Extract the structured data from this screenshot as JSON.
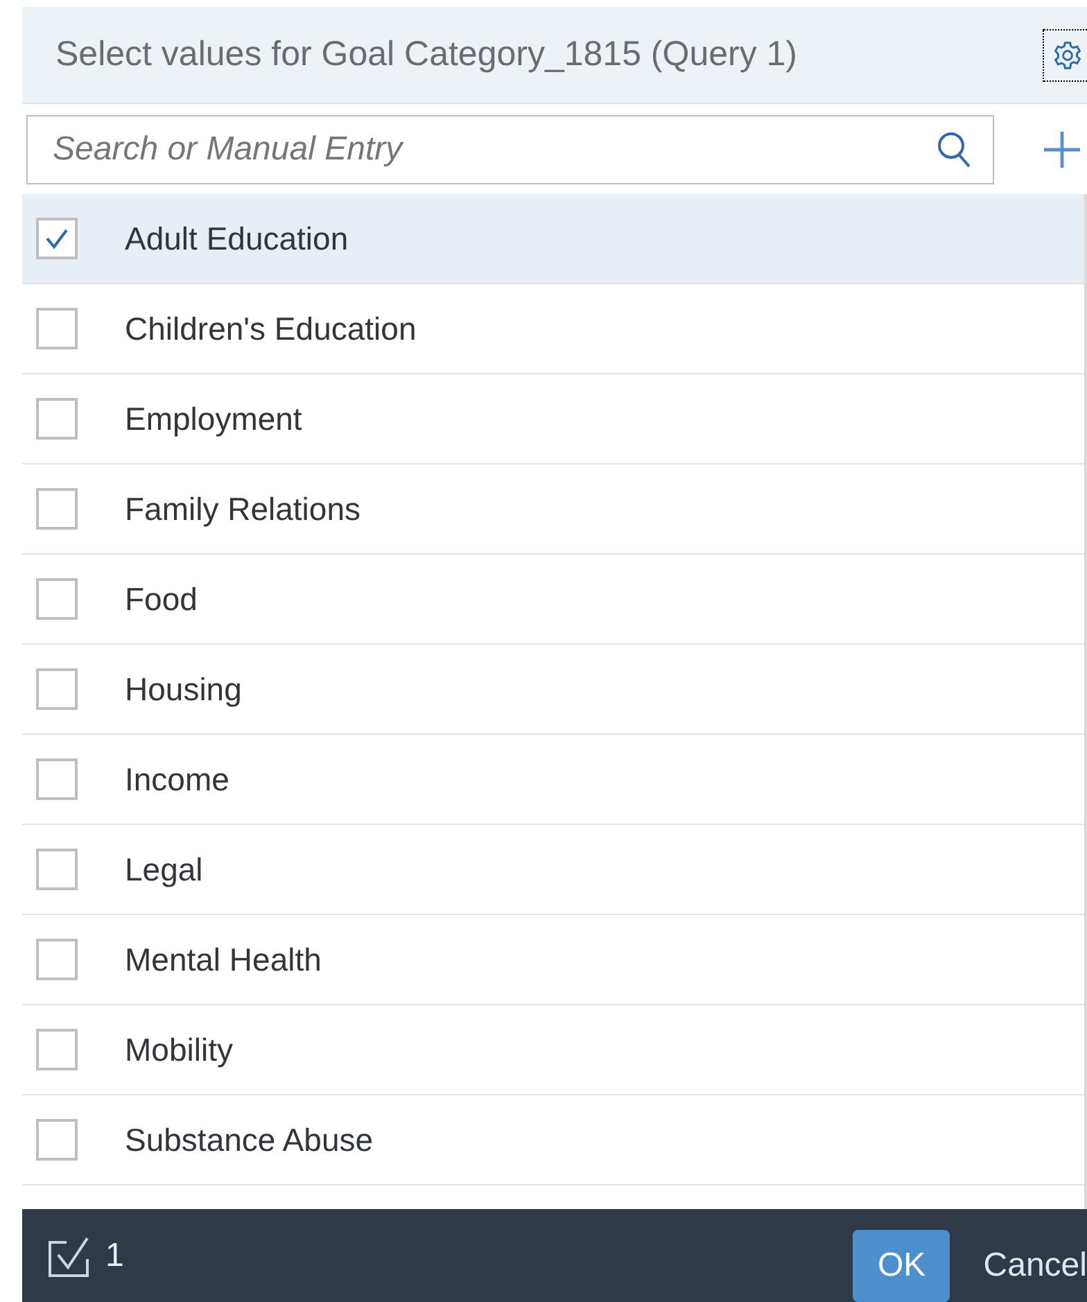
{
  "dialog": {
    "title": "Select values for Goal Category_1815 (Query 1)"
  },
  "search": {
    "placeholder": "Search or Manual Entry"
  },
  "items": [
    {
      "label": "Adult Education",
      "checked": true
    },
    {
      "label": "Children's Education",
      "checked": false
    },
    {
      "label": "Employment",
      "checked": false
    },
    {
      "label": "Family Relations",
      "checked": false
    },
    {
      "label": "Food",
      "checked": false
    },
    {
      "label": "Housing",
      "checked": false
    },
    {
      "label": "Income",
      "checked": false
    },
    {
      "label": "Legal",
      "checked": false
    },
    {
      "label": "Mental Health",
      "checked": false
    },
    {
      "label": "Mobility",
      "checked": false
    },
    {
      "label": "Substance Abuse",
      "checked": false
    }
  ],
  "footer": {
    "selected_count": "1",
    "buttons": [
      "OK",
      "Cancel"
    ]
  }
}
